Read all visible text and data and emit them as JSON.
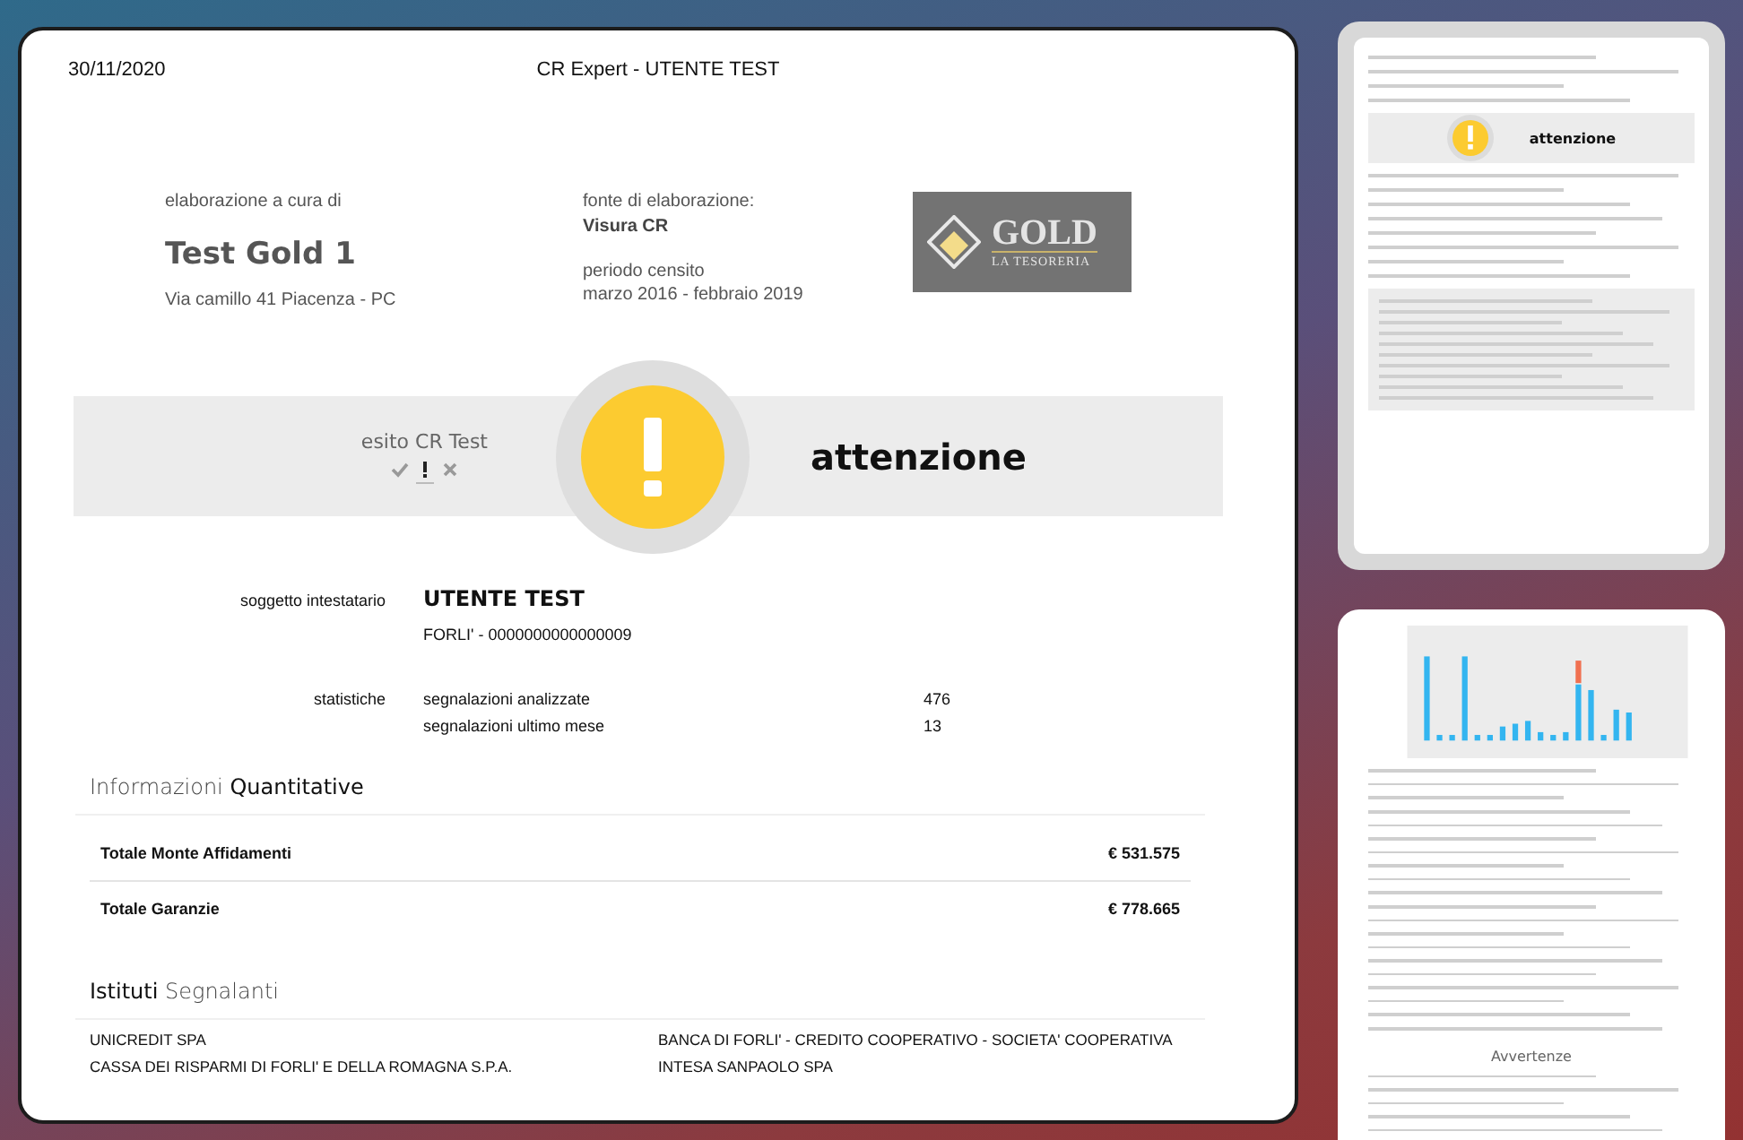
{
  "header": {
    "date": "30/11/2020",
    "title": "CR Expert - UTENTE TEST"
  },
  "report": {
    "prepared_by_label": "elaborazione a cura di",
    "prepared_by": "Test Gold 1",
    "address": "Via camillo 41 Piacenza - PC",
    "source_label": "fonte di elaborazione:",
    "source": "Visura CR",
    "period_label": "periodo censito",
    "period": "marzo 2016 - febbraio 2019",
    "logo": {
      "title": "GOLD",
      "subtitle": "LA TESORERIA"
    }
  },
  "outcome": {
    "label": "esito CR Test",
    "indicators": [
      {
        "kind": "ok",
        "selected": false
      },
      {
        "kind": "warning",
        "selected": true
      },
      {
        "kind": "fail",
        "selected": false
      }
    ],
    "result": "attenzione"
  },
  "subject": {
    "label": "soggetto intestatario",
    "name": "UTENTE TEST",
    "detail": "FORLI' - 0000000000000009"
  },
  "statistics": {
    "label": "statistiche",
    "rows": [
      {
        "name": "segnalazioni analizzate",
        "value": "476"
      },
      {
        "name": "segnalazioni ultimo mese",
        "value": "13"
      }
    ]
  },
  "quantitative": {
    "title": "Informazioni **Quantitative**",
    "rows": [
      {
        "name": "Totale Monte Affidamenti",
        "value": "€ 531.575"
      },
      {
        "name": "Totale Garanzie",
        "value": "€ 778.665"
      }
    ]
  },
  "institutes": {
    "title": "**Istituti** Segnalanti",
    "items": [
      "UNICREDIT SPA",
      "BANCA DI FORLI' - CREDITO COOPERATIVO - SOCIETA' COOPERATIVA",
      "CASSA DEI RISPARMI DI FORLI' E DELLA ROMAGNA S.P.A.",
      "INTESA SANPAOLO SPA"
    ]
  },
  "thumbnails": [
    {
      "kind": "summary",
      "selected": true,
      "caption": "attenzione"
    },
    {
      "kind": "chart",
      "selected": false,
      "caption": "Avvertenze"
    }
  ]
}
